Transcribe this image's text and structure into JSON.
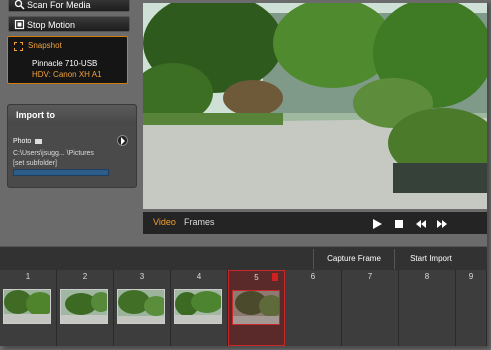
{
  "buttons": {
    "scan": "Scan For Media",
    "stop": "Stop Motion"
  },
  "snapshot": {
    "title": "Snapshot",
    "device": "Pinnacle 710-USB",
    "source": "HDV: Canon XH A1"
  },
  "import": {
    "title": "Import to",
    "photo_label": "Photo",
    "path": "C:\\Users\\jsugg...  \\Pictures",
    "subfolder": "[set subfolder]"
  },
  "video": {
    "tab_video": "Video",
    "tab_frames": "Frames"
  },
  "actions": {
    "capture": "Capture Frame",
    "start_import": "Start Import"
  },
  "timeline": {
    "slots": [
      "1",
      "2",
      "3",
      "4",
      "5",
      "6",
      "7",
      "8",
      "9"
    ],
    "active_index": 5
  },
  "colors": {
    "accent": "#f0a030",
    "active_border": "#c82828"
  }
}
